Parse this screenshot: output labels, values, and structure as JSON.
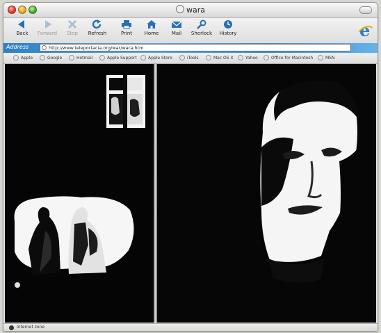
{
  "window": {
    "title": "wara"
  },
  "toolbar": {
    "back": "Back",
    "forward": "Forward",
    "stop": "Stop",
    "refresh": "Refresh",
    "print": "Print",
    "home": "Home",
    "mail": "Mail",
    "sherlock": "Sherlock",
    "history": "History"
  },
  "address": {
    "label": "Address",
    "url": "http://www.teleportacia.org/war/wara.htm"
  },
  "favorites": [
    "Apple",
    "Google",
    "Hotmail",
    "Apple Support",
    "Apple Store",
    "iTools",
    "Mac OS X",
    "Yahoo",
    "Office for Macintosh",
    "MSN"
  ],
  "status": {
    "text": "Internet zone"
  },
  "colors": {
    "accent": "#3b8bd0",
    "toolbar_icon": "#2a6fb5",
    "content_bg": "#000000"
  }
}
